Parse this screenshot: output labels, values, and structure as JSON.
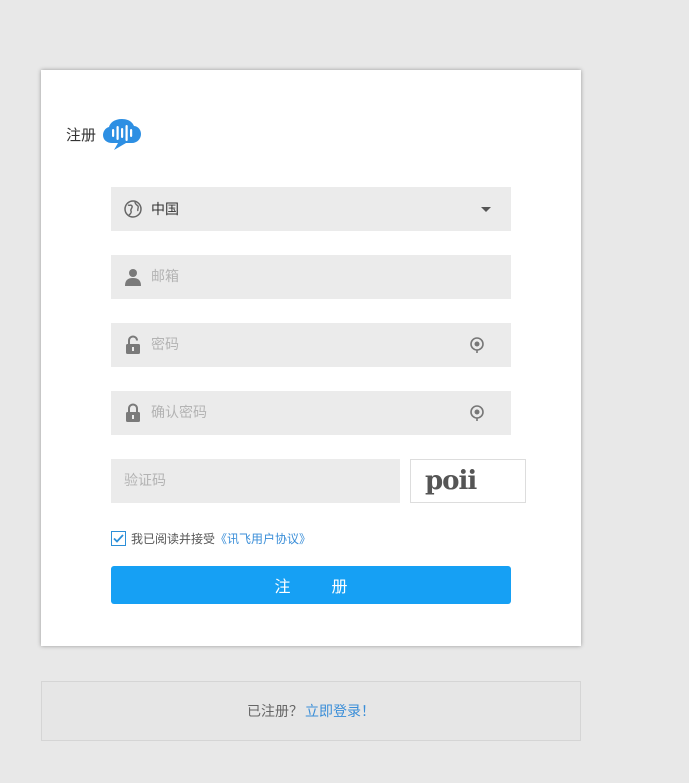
{
  "header": {
    "title": "注册"
  },
  "form": {
    "country": {
      "value": "中国",
      "icon": "globe-icon"
    },
    "email": {
      "placeholder": "邮箱",
      "icon": "user-icon"
    },
    "password": {
      "placeholder": "密码",
      "icon": "lock-icon",
      "toggle_icon": "eye-toggle-icon"
    },
    "confirm_password": {
      "placeholder": "确认密码",
      "icon": "lock-icon",
      "toggle_icon": "eye-toggle-icon"
    },
    "captcha": {
      "placeholder": "验证码",
      "image_text": "poii"
    },
    "agreement": {
      "checked": true,
      "text": "我已阅读并接受",
      "link_text": "《讯飞用户协议》"
    },
    "submit_label": "注 册"
  },
  "footer": {
    "text": "已注册？",
    "link_text": "立即登录！"
  },
  "colors": {
    "accent": "#16a0f4",
    "link": "#3a8ed8",
    "field_bg": "#ebebeb",
    "page_bg": "#e8e8e8"
  }
}
